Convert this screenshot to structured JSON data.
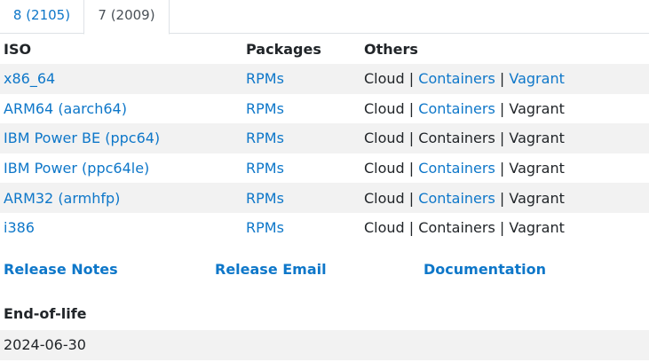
{
  "tabs": [
    {
      "label": "8 (2105)"
    },
    {
      "label": "7 (2009)"
    }
  ],
  "table": {
    "headers": [
      "ISO",
      "Packages",
      "Others"
    ],
    "rows": [
      {
        "iso": "x86_64",
        "packages": "RPMs",
        "cloud": "Cloud",
        "containers": "Containers",
        "vagrant": "Vagrant",
        "sep": "|"
      },
      {
        "iso": "ARM64 (aarch64)",
        "packages": "RPMs",
        "cloud": "Cloud",
        "containers": "Containers",
        "vagrant": "Vagrant",
        "sep": "|"
      },
      {
        "iso": "IBM Power BE (ppc64)",
        "packages": "RPMs",
        "cloud": "Cloud",
        "containers": "Containers",
        "vagrant": "Vagrant",
        "sep": "|"
      },
      {
        "iso": "IBM Power (ppc64le)",
        "packages": "RPMs",
        "cloud": "Cloud",
        "containers": "Containers",
        "vagrant": "Vagrant",
        "sep": "|"
      },
      {
        "iso": "ARM32 (armhfp)",
        "packages": "RPMs",
        "cloud": "Cloud",
        "containers": "Containers",
        "vagrant": "Vagrant",
        "sep": "|"
      },
      {
        "iso": "i386",
        "packages": "RPMs",
        "cloud": "Cloud",
        "containers": "Containers",
        "vagrant": "Vagrant",
        "sep": "|"
      }
    ]
  },
  "links": {
    "release_notes": "Release Notes",
    "release_email": "Release Email",
    "documentation": "Documentation"
  },
  "eol": {
    "heading": "End-of-life",
    "date": "2024-06-30"
  },
  "colors": {
    "link": "#0e77c9",
    "stripe": "#f2f2f2",
    "text": "#212529"
  }
}
